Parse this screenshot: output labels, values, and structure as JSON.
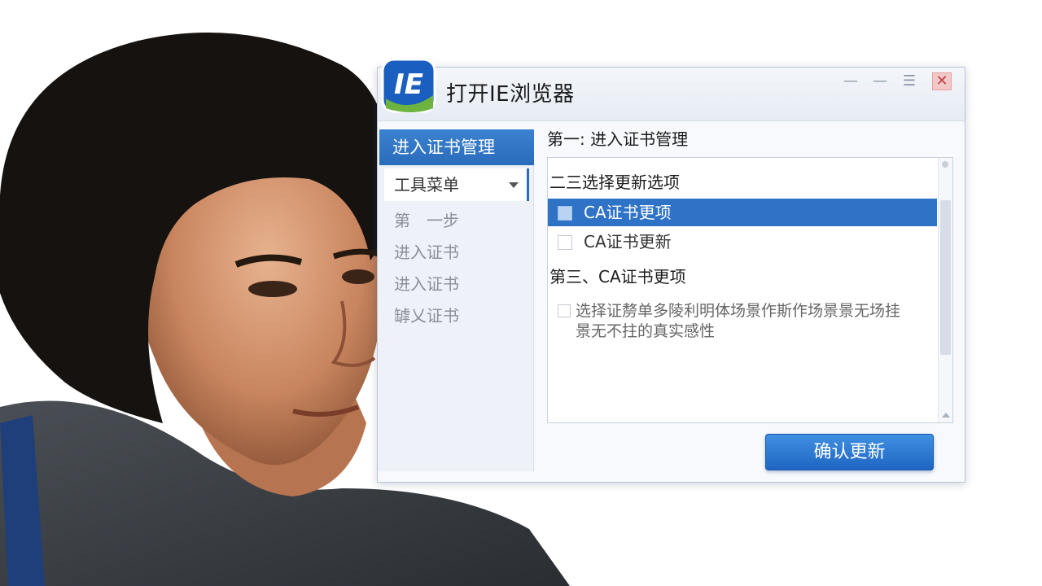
{
  "window": {
    "title": "打开IE浏览器",
    "logo_text": "IE"
  },
  "sidebar": {
    "header": "进入证书管理",
    "dropdown": "工具菜单",
    "items": [
      "第　一步",
      "进入证书",
      "进入证书",
      "罅乂证书"
    ]
  },
  "main": {
    "step_heading": "第一: 进入证书管理",
    "section1_title": "二三选择更新选项",
    "options": [
      {
        "label": "CA证书更项",
        "selected": true
      },
      {
        "label": "CA证书更新",
        "selected": false
      }
    ],
    "section2_title": "第三、CA证书更项",
    "description_line1": "选择证剺单多陵利明体场景作斯作场景景无场挂",
    "description_line2": "景无不拄的真实感性"
  },
  "buttons": {
    "confirm": "确认更新"
  },
  "icons": [
    "ie-logo-icon",
    "minimize-icon",
    "maximize-icon",
    "close-icon",
    "chevron-down-icon"
  ],
  "colors": {
    "accent": "#2f73c6",
    "button": "#1f66c2",
    "close": "#f2c9c9"
  }
}
